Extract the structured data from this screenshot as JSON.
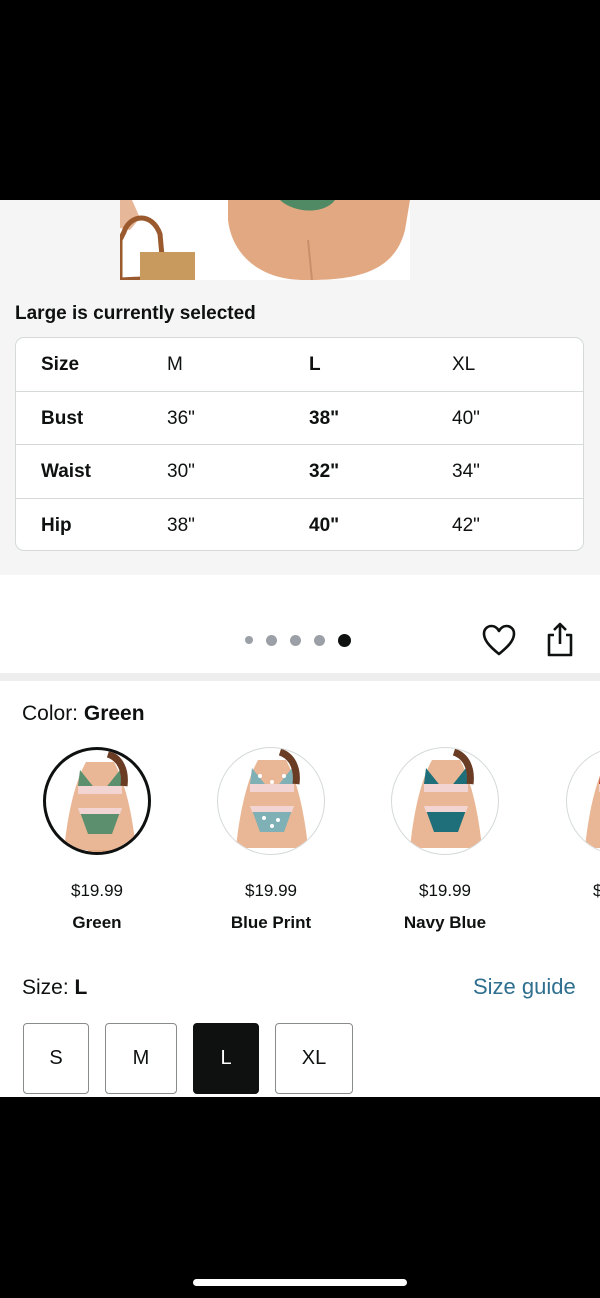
{
  "size_chart": {
    "selected_text": "Large is currently selected",
    "headers": [
      "Size",
      "M",
      "L",
      "XL"
    ],
    "rows": [
      {
        "label": "Bust",
        "M": "36\"",
        "L": "38\"",
        "XL": "40\""
      },
      {
        "label": "Waist",
        "M": "30\"",
        "L": "32\"",
        "XL": "34\""
      },
      {
        "label": "Hip",
        "M": "38\"",
        "L": "40\"",
        "XL": "42\""
      }
    ]
  },
  "carousel": {
    "page_count": 5,
    "active_index": 4,
    "icons": [
      "heart-icon",
      "share-icon"
    ]
  },
  "color_selector": {
    "label": "Color: ",
    "selected": "Green",
    "options": [
      {
        "name": "Green",
        "price": "$19.99",
        "color": "#5b8f6e",
        "selected": true
      },
      {
        "name": "Blue Print",
        "price": "$19.99",
        "color": "#7fb0b5",
        "selected": false
      },
      {
        "name": "Navy Blue",
        "price": "$19.99",
        "color": "#1f6f7a",
        "selected": false
      },
      {
        "name": "",
        "price": "$",
        "color": "#c0392b",
        "selected": false
      }
    ]
  },
  "size_selector": {
    "label": "Size: ",
    "selected": "L",
    "size_guide_label": "Size guide",
    "options": [
      "S",
      "M",
      "L",
      "XL"
    ]
  },
  "colors": {
    "link": "#2f6f8f",
    "text": "#0f1111",
    "panel_bg": "#f5f5f5"
  }
}
